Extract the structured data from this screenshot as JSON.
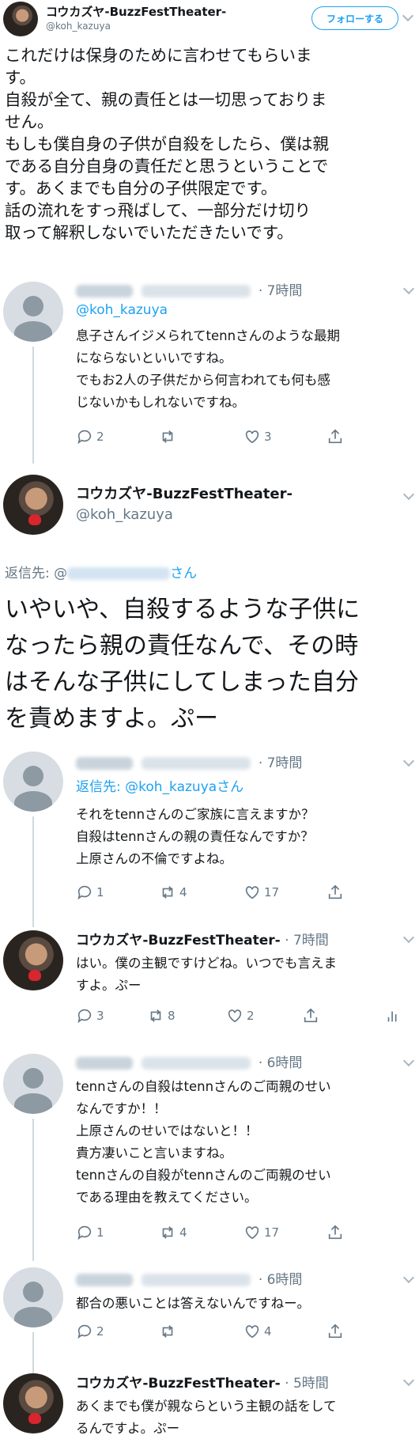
{
  "header": {
    "name": "コウカズヤ-BuzzFestTheater-",
    "handle": "@koh_kazuya",
    "follow_label": "フォローする"
  },
  "main_tweet": {
    "text_lines": [
      "これだけは保身のために言わせてもらいま",
      "す。",
      "自殺が全て、親の責任とは一切思っておりま",
      "せん。",
      "もしも僕自身の子供が自殺をしたら、僕は親",
      "である自分自身の責任だと思うということで",
      "す。あくまでも自分の子供限定です。",
      "話の流れをすっ飛ばして、一部分だけ切り",
      "取って解釈しないでいただきたいです。"
    ]
  },
  "reply1": {
    "time": "· 7時間",
    "mention": "@koh_kazuya",
    "text_lines": [
      "息子さんイジメられてtennさんのような最期",
      "にならないといいですね。",
      "でもお2人の子供だから何言われても何も感",
      "じないかもしれないですね。"
    ],
    "replies": "2",
    "retweets": "",
    "likes": "3"
  },
  "focus_tweet": {
    "name": "コウカズヤ-BuzzFestTheater-",
    "handle": "@koh_kazuya",
    "reply_to_prefix": "返信先: @",
    "reply_to_suffix": "さん",
    "text_lines": [
      "いやいや、自殺するような子供に",
      "なったら親の責任なんで、その時",
      "はそんな子供にしてしまった自分",
      "を責めますよ。ぷー"
    ]
  },
  "reply2": {
    "time": "· 7時間",
    "reply_to": "返信先: @koh_kazuyaさん",
    "text_lines": [
      "それをtennさんのご家族に言えますか？",
      "自殺はtennさんの親の責任なんですか？",
      "上原さんの不倫ですよね。"
    ],
    "replies": "1",
    "retweets": "4",
    "likes": "17"
  },
  "reply3": {
    "name": "コウカズヤ-BuzzFestTheater-",
    "time": "· 7時間",
    "text_lines": [
      "はい。僕の主観ですけどね。いつでも言えま",
      "すよ。ぷー"
    ],
    "replies": "3",
    "retweets": "8",
    "likes": "2"
  },
  "reply4": {
    "time": "· 6時間",
    "text_lines": [
      "tennさんの自殺はtennさんのご両親のせい",
      "なんですか！！",
      "上原さんのせいではないと！！",
      "貴方凄いこと言いますね。",
      "tennさんの自殺がtennさんのご両親のせい",
      "である理由を教えてください。"
    ],
    "replies": "1",
    "retweets": "4",
    "likes": "17"
  },
  "reply5": {
    "time": "· 6時間",
    "text_lines": [
      "都合の悪いことは答えないんですねー。"
    ],
    "replies": "2",
    "retweets": "",
    "likes": "4"
  },
  "reply6": {
    "name": "コウカズヤ-BuzzFestTheater-",
    "time": "· 5時間",
    "text_lines": [
      "あくまでも僕が親ならという主観の話をして",
      "るんですよ。ぷー"
    ]
  },
  "colors": {
    "accent": "#1da1f2",
    "muted": "#657786",
    "text": "#14171a"
  }
}
